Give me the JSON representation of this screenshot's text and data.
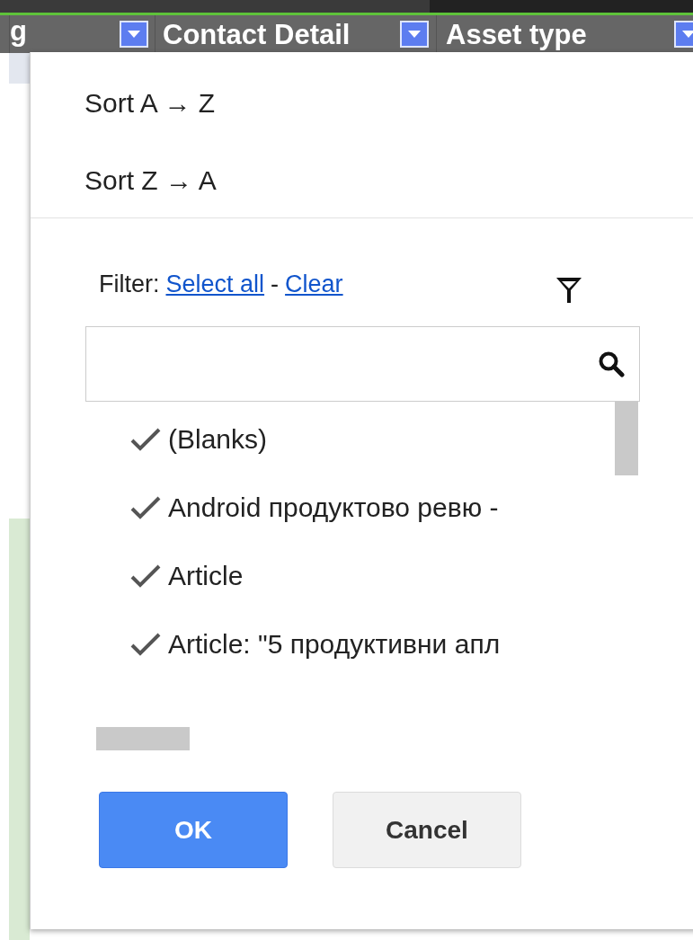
{
  "columns": [
    {
      "label": "g"
    },
    {
      "label": "Contact Detail"
    },
    {
      "label": "Asset type"
    }
  ],
  "menu": {
    "sort": [
      "Sort A → Z",
      "Sort Z → A"
    ],
    "filter": {
      "label": "Filter:",
      "select_all": "Select all",
      "separator": "-",
      "clear": "Clear"
    },
    "items": [
      {
        "label": "(Blanks)",
        "checked": true
      },
      {
        "label": "Android продуктово ревю -",
        "checked": true
      },
      {
        "label": "Article",
        "checked": true
      },
      {
        "label": "Article: \"5 продуктивни апл",
        "checked": true
      }
    ],
    "buttons": [
      {
        "label": "OK",
        "kind": "primary"
      },
      {
        "label": "Cancel",
        "kind": "secondary"
      }
    ]
  }
}
